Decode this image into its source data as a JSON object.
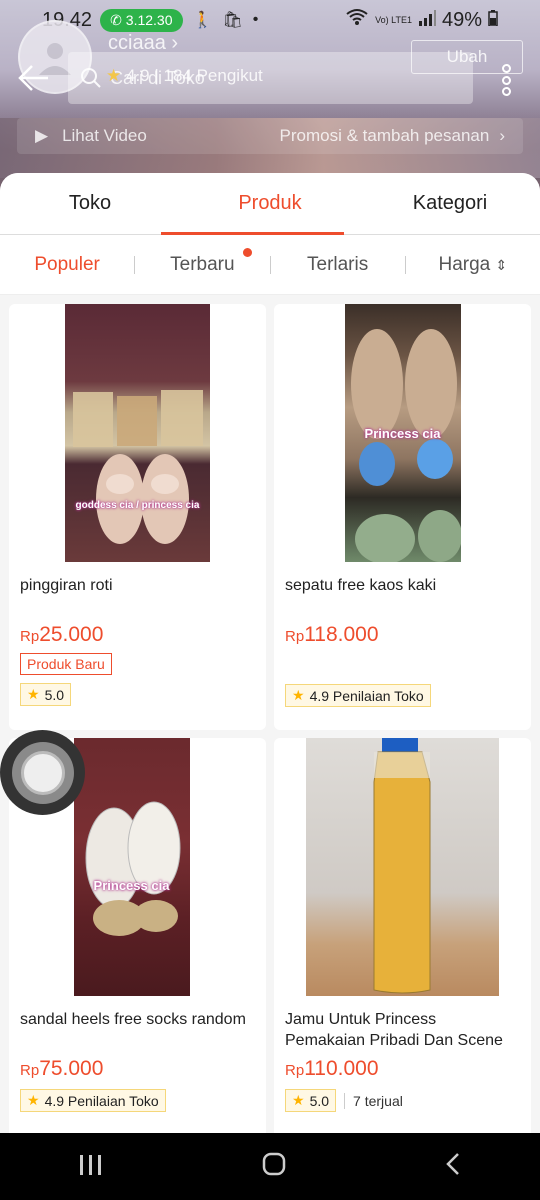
{
  "status": {
    "time": "19.42",
    "call_timer": "3.12.30",
    "battery": "49%",
    "network": "Vo) LTE1"
  },
  "shop": {
    "name": "cciaaa",
    "search_placeholder": "Cari di Toko",
    "rating": "4.9",
    "followers": "184 Pengikut",
    "edit_label": "Ubah",
    "video_label": "Lihat Video",
    "promo_label": "Promosi & tambah pesanan"
  },
  "tabs": [
    {
      "label": "Toko"
    },
    {
      "label": "Produk"
    },
    {
      "label": "Kategori"
    }
  ],
  "sort": [
    {
      "label": "Populer"
    },
    {
      "label": "Terbaru"
    },
    {
      "label": "Terlaris"
    },
    {
      "label": "Harga"
    }
  ],
  "products": [
    {
      "title": "pinggiran roti",
      "currency": "Rp",
      "price": "25.000",
      "badge": "Produk Baru",
      "rating": "5.0",
      "watermark": "goddess cia / princess cia"
    },
    {
      "title": "sepatu free kaos kaki",
      "currency": "Rp",
      "price": "118.000",
      "rating": "4.9 Penilaian Toko",
      "watermark": "Princess cia"
    },
    {
      "title": "sandal heels free socks random",
      "currency": "Rp",
      "price": "75.000",
      "rating": "4.9 Penilaian Toko",
      "watermark": "Princess cia"
    },
    {
      "title": "Jamu Untuk Princess Pemakaian Pribadi Dan Scene",
      "currency": "Rp",
      "price": "110.000",
      "rating": "5.0",
      "sold": "7 terjual"
    }
  ],
  "colors": {
    "accent": "#ee4d2d",
    "call_green": "#2db34a",
    "rating_bg": "#fff8e4"
  },
  "icons": {
    "back": "back-arrow-icon",
    "search": "search-icon",
    "more": "more-vertical-icon",
    "video": "play-icon",
    "star": "star-icon"
  }
}
